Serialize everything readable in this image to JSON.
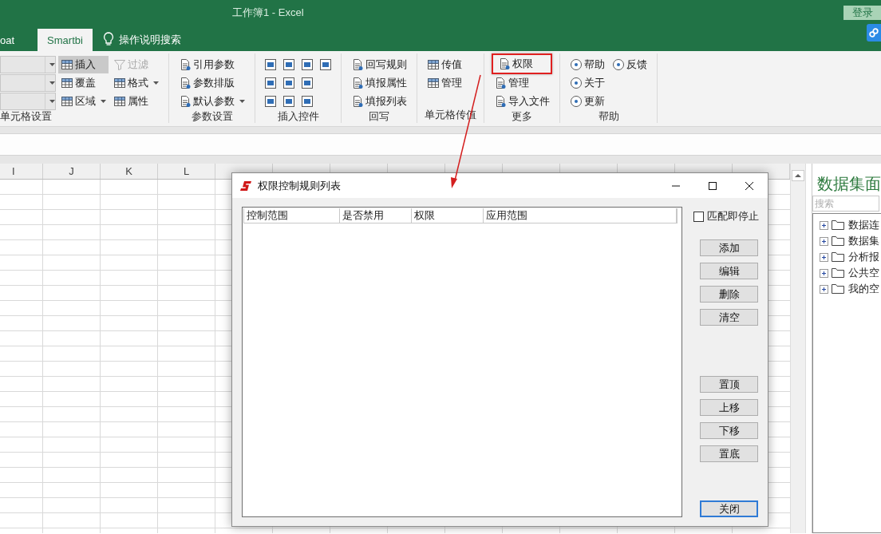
{
  "window": {
    "title": "工作簿1  -  Excel",
    "login_button": "登录"
  },
  "ribbon_tabs": [
    {
      "label": "oat",
      "selected": false
    },
    {
      "label": "Smartbi",
      "selected": true
    }
  ],
  "tell_me": {
    "label": "操作说明搜索"
  },
  "ribbon_groups": [
    {
      "label": "单元格设置",
      "columns": [
        [
          {
            "kind": "combo",
            "disabled": true
          },
          {
            "kind": "combo",
            "disabled": true
          },
          {
            "kind": "combo",
            "disabled": true
          }
        ],
        [
          {
            "kind": "button",
            "label": "插入",
            "selected": true,
            "disabled": false,
            "highlighted": false
          },
          {
            "kind": "button",
            "label": "覆盖",
            "selected": false,
            "disabled": false,
            "highlighted": false
          },
          {
            "kind": "dropdown",
            "label": "区域",
            "selected": false,
            "disabled": false,
            "highlighted": false
          }
        ],
        [
          {
            "kind": "button",
            "label": "过滤",
            "selected": false,
            "disabled": true,
            "highlighted": false
          },
          {
            "kind": "dropdown",
            "label": "格式",
            "selected": false,
            "disabled": false,
            "highlighted": false
          },
          {
            "kind": "button",
            "label": "属性",
            "selected": false,
            "disabled": false,
            "highlighted": false
          }
        ]
      ]
    },
    {
      "label": "参数设置",
      "columns": [
        [
          {
            "kind": "button",
            "label": "引用参数",
            "selected": false,
            "disabled": false,
            "highlighted": false
          },
          {
            "kind": "button",
            "label": "参数排版",
            "selected": false,
            "disabled": false,
            "highlighted": false
          },
          {
            "kind": "dropdown",
            "label": "默认参数",
            "selected": false,
            "disabled": false,
            "highlighted": false
          }
        ]
      ]
    },
    {
      "label": "插入控件",
      "columns": [
        [
          {
            "kind": "icon"
          },
          {
            "kind": "icon"
          },
          {
            "kind": "icon"
          }
        ],
        [
          {
            "kind": "icon"
          },
          {
            "kind": "icon"
          },
          {
            "kind": "icon"
          }
        ],
        [
          {
            "kind": "icon"
          },
          {
            "kind": "icon"
          },
          {
            "kind": "icon"
          }
        ],
        [
          {
            "kind": "icon"
          }
        ]
      ]
    },
    {
      "label": "回写",
      "columns": [
        [
          {
            "kind": "button",
            "label": "回写规则",
            "selected": false,
            "disabled": false,
            "highlighted": false
          },
          {
            "kind": "button",
            "label": "填报属性",
            "selected": false,
            "disabled": false,
            "highlighted": false
          },
          {
            "kind": "button",
            "label": "填报列表",
            "selected": false,
            "disabled": false,
            "highlighted": false
          }
        ]
      ]
    },
    {
      "label": "单元格传值",
      "columns": [
        [
          {
            "kind": "button",
            "label": "传值",
            "selected": false,
            "disabled": false,
            "highlighted": false
          },
          {
            "kind": "button",
            "label": "管理",
            "selected": false,
            "disabled": false,
            "highlighted": false
          }
        ]
      ]
    },
    {
      "label": "更多",
      "columns": [
        [
          {
            "kind": "button",
            "label": "权限",
            "selected": false,
            "disabled": false,
            "highlighted": true
          },
          {
            "kind": "button",
            "label": "管理",
            "selected": false,
            "disabled": false,
            "highlighted": false
          },
          {
            "kind": "button",
            "label": "导入文件",
            "selected": false,
            "disabled": false,
            "highlighted": false
          }
        ]
      ]
    },
    {
      "label": "帮助",
      "columns": [
        [
          {
            "kind": "button",
            "label": "帮助",
            "selected": false,
            "disabled": false,
            "highlighted": false
          },
          {
            "kind": "button",
            "label": "关于",
            "selected": false,
            "disabled": false,
            "highlighted": false
          },
          {
            "kind": "button",
            "label": "更新",
            "selected": false,
            "disabled": false,
            "highlighted": false
          }
        ],
        [
          {
            "kind": "button",
            "label": "反馈",
            "selected": false,
            "disabled": false,
            "highlighted": false
          }
        ]
      ]
    }
  ],
  "sheet": {
    "columns": [
      "I",
      "J",
      "K",
      "L"
    ]
  },
  "panel": {
    "title": "数据集面",
    "search": {
      "placeholder": "搜索"
    },
    "tree": [
      {
        "label": "数据连",
        "expanded": false
      },
      {
        "label": "数据集",
        "expanded": false
      },
      {
        "label": "分析报",
        "expanded": false
      },
      {
        "label": "公共空",
        "expanded": false
      },
      {
        "label": "我的空",
        "expanded": false
      }
    ]
  },
  "dialog": {
    "title": "权限控制规则列表",
    "table": {
      "columns": [
        "控制范围",
        "是否禁用",
        "权限",
        "应用范围"
      ]
    },
    "stop_on_match": {
      "label": "匹配即停止",
      "checked": false
    },
    "button_groups": [
      [
        {
          "label": "添加",
          "default": false
        },
        {
          "label": "编辑",
          "default": false
        },
        {
          "label": "删除",
          "default": false
        },
        {
          "label": "清空",
          "default": false
        }
      ],
      [
        {
          "label": "置顶",
          "default": false
        },
        {
          "label": "上移",
          "default": false
        },
        {
          "label": "下移",
          "default": false
        },
        {
          "label": "置底",
          "default": false
        }
      ],
      [
        {
          "label": "关闭",
          "default": true
        }
      ]
    ]
  }
}
